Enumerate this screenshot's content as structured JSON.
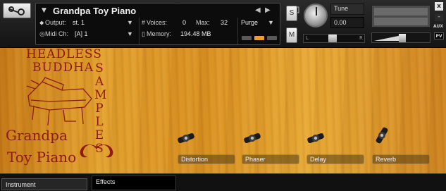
{
  "header": {
    "instrument_name": "Grandpa Toy Piano",
    "output_label": "Output:",
    "output_value": "st. 1",
    "voices_label": "Voices:",
    "voices_value": "0",
    "max_label": "Max:",
    "max_value": "32",
    "purge_label": "Purge",
    "midi_label": "Midi Ch:",
    "midi_value": "[A]  1",
    "memory_label": "Memory:",
    "memory_value": "194.48 MB",
    "solo_label": "S",
    "mute_label": "M",
    "tune_label": "Tune",
    "tune_value": "0.00",
    "pan_left": "L",
    "pan_right": "R",
    "aux_label": "AUX",
    "pv_label": "PV",
    "close_glyph": "x",
    "minus_glyph": "-"
  },
  "logo": {
    "line1": "HEADLESS",
    "line2": "BUDDHA",
    "vertical": "SAMPLES",
    "product_line1": "Grandpa",
    "product_line2": "Toy Piano"
  },
  "effects": [
    {
      "label": "Distortion",
      "state": "off"
    },
    {
      "label": "Phaser",
      "state": "off"
    },
    {
      "label": "Delay",
      "state": "off"
    },
    {
      "label": "Reverb",
      "state": "on"
    }
  ],
  "tabs": {
    "instrument": "Instrument",
    "effects": "Effects"
  },
  "colors": {
    "logo_red": "#8e1a12",
    "accent_orange": "#f0a020"
  }
}
